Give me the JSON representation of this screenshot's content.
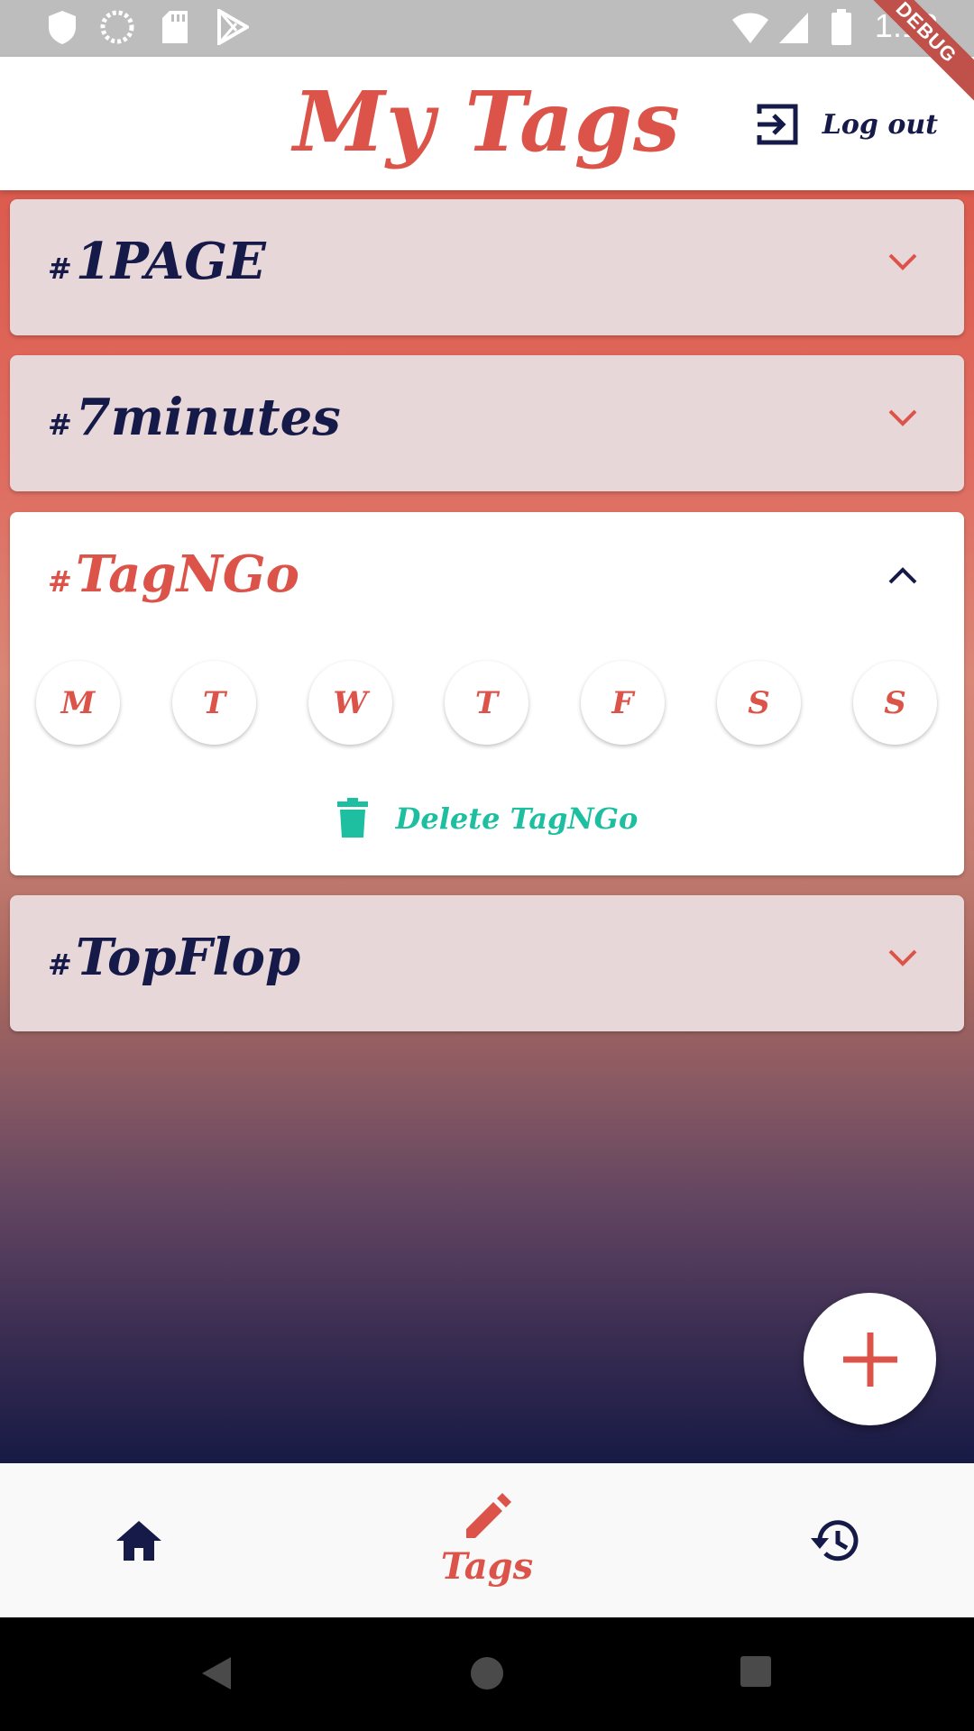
{
  "status_bar": {
    "time": "1:12",
    "left_icons": [
      "shield-icon",
      "sync-icon",
      "sd-card-icon",
      "play-store-icon"
    ],
    "right_icons": [
      "wifi-icon",
      "signal-icon",
      "battery-icon"
    ],
    "debug_banner": "DEBUG"
  },
  "app_bar": {
    "title": "My Tags",
    "logout_label": "Log out"
  },
  "colors": {
    "accent": "#dc5449",
    "navy": "#161a48",
    "teal": "#1ebfa0",
    "card_collapsed": "#e7d7d8"
  },
  "tags": [
    {
      "hash": "#",
      "name": "1PAGE",
      "expanded": false
    },
    {
      "hash": "#",
      "name": "7minutes",
      "expanded": false
    },
    {
      "hash": "#",
      "name": "TagNGo",
      "expanded": true
    },
    {
      "hash": "#",
      "name": "TopFlop",
      "expanded": false
    }
  ],
  "days": [
    "M",
    "T",
    "W",
    "T",
    "F",
    "S",
    "S"
  ],
  "delete_label": "Delete TagNGo",
  "bottom_nav": {
    "items": [
      {
        "icon": "home-icon",
        "label": ""
      },
      {
        "icon": "pencil-icon",
        "label": "Tags"
      },
      {
        "icon": "history-icon",
        "label": ""
      }
    ],
    "active_index": 1
  },
  "fab_icon": "plus-icon"
}
